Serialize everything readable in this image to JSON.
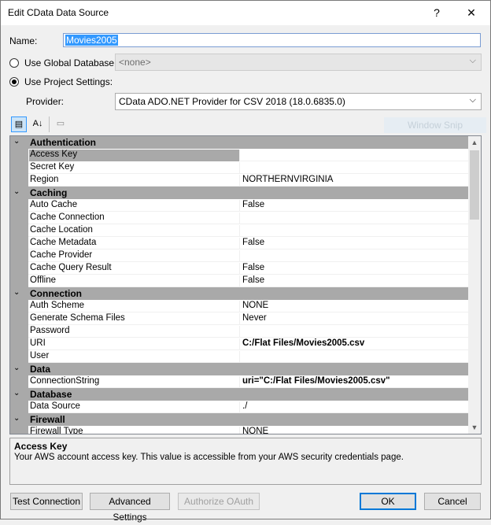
{
  "window": {
    "title": "Edit CData Data Source",
    "help_glyph": "?",
    "close_glyph": "✕"
  },
  "form": {
    "name_label": "Name:",
    "name_value": "Movies2005",
    "global_db_label": "Use Global Database:",
    "global_db_value": "<none>",
    "project_settings_label": "Use Project Settings:",
    "provider_label": "Provider:",
    "provider_value": "CData ADO.NET Provider for CSV 2018 (18.0.6835.0)",
    "selected_radio": "project_settings"
  },
  "toolbar": {
    "categorized_glyph": "▤",
    "alphabetical_glyph": "A↓",
    "pages_glyph": "▭",
    "window_snip": "Window Snip"
  },
  "grid": {
    "rows": [
      {
        "type": "category",
        "name": "Authentication"
      },
      {
        "type": "prop",
        "name": "Access Key",
        "value": "",
        "selected": true
      },
      {
        "type": "prop",
        "name": "Secret Key",
        "value": ""
      },
      {
        "type": "prop",
        "name": "Region",
        "value": "NORTHERNVIRGINIA"
      },
      {
        "type": "category",
        "name": "Caching"
      },
      {
        "type": "prop",
        "name": "Auto Cache",
        "value": "False"
      },
      {
        "type": "prop",
        "name": "Cache Connection",
        "value": ""
      },
      {
        "type": "prop",
        "name": "Cache Location",
        "value": ""
      },
      {
        "type": "prop",
        "name": "Cache Metadata",
        "value": "False"
      },
      {
        "type": "prop",
        "name": "Cache Provider",
        "value": ""
      },
      {
        "type": "prop",
        "name": "Cache Query Result",
        "value": "False"
      },
      {
        "type": "prop",
        "name": "Offline",
        "value": "False"
      },
      {
        "type": "category",
        "name": "Connection"
      },
      {
        "type": "prop",
        "name": "Auth Scheme",
        "value": "NONE"
      },
      {
        "type": "prop",
        "name": "Generate Schema Files",
        "value": "Never"
      },
      {
        "type": "prop",
        "name": "Password",
        "value": ""
      },
      {
        "type": "prop",
        "name": "URI",
        "value": "C:/Flat Files/Movies2005.csv",
        "bold": true
      },
      {
        "type": "prop",
        "name": "User",
        "value": ""
      },
      {
        "type": "category",
        "name": "Data"
      },
      {
        "type": "prop",
        "name": "ConnectionString",
        "value": "uri=\"C:/Flat Files/Movies2005.csv\"",
        "bold": true
      },
      {
        "type": "category",
        "name": "Database"
      },
      {
        "type": "prop",
        "name": "Data Source",
        "value": "./"
      },
      {
        "type": "category",
        "name": "Firewall"
      },
      {
        "type": "prop",
        "name": "Firewall Type",
        "value": "NONE"
      }
    ]
  },
  "description": {
    "title": "Access Key",
    "text": "Your AWS account access key. This value is accessible from your AWS security credentials page."
  },
  "buttons": {
    "test_connection": "Test Connection",
    "advanced_settings": "Advanced Settings",
    "authorize_oauth": "Authorize OAuth",
    "ok": "OK",
    "cancel": "Cancel"
  }
}
